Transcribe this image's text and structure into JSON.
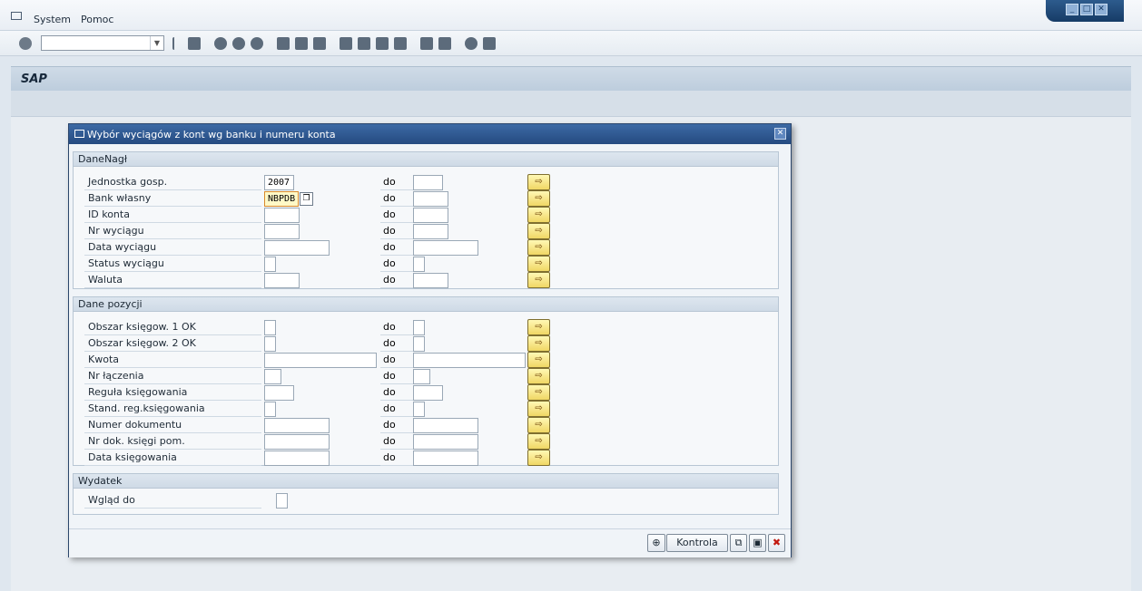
{
  "menu": {
    "system": "System",
    "pomoc": "Pomoc"
  },
  "window_controls": {
    "minimize": "_",
    "maximize": "□",
    "close": "✕"
  },
  "app": {
    "title": "SAP"
  },
  "dialog": {
    "title": "Wybór wyciągów z kont wg banku i numeru konta",
    "close": "✕",
    "groups": {
      "danenagl": {
        "title": "DaneNagł",
        "rows": [
          {
            "label": "Jednostka gosp.",
            "from": "2007",
            "to": "",
            "to_label": "do",
            "more": "⇨"
          },
          {
            "label": "Bank własny",
            "from": "NBPDB",
            "to": "",
            "to_label": "do",
            "more": "⇨"
          },
          {
            "label": "ID konta",
            "from": "",
            "to": "",
            "to_label": "do",
            "more": "⇨"
          },
          {
            "label": "Nr wyciągu",
            "from": "",
            "to": "",
            "to_label": "do",
            "more": "⇨"
          },
          {
            "label": "Data wyciągu",
            "from": "",
            "to": "",
            "to_label": "do",
            "more": "⇨"
          },
          {
            "label": "Status wyciągu",
            "from": "",
            "to": "",
            "to_label": "do",
            "more": "⇨"
          },
          {
            "label": "Waluta",
            "from": "",
            "to": "",
            "to_label": "do",
            "more": "⇨"
          }
        ]
      },
      "pozycji": {
        "title": "Dane pozycji",
        "rows": [
          {
            "label": "Obszar księgow. 1 OK",
            "from": "",
            "to": "",
            "to_label": "do",
            "more": "⇨"
          },
          {
            "label": "Obszar księgow. 2 OK",
            "from": "",
            "to": "",
            "to_label": "do",
            "more": "⇨"
          },
          {
            "label": "Kwota",
            "from": "",
            "to": "",
            "to_label": "do",
            "more": "⇨"
          },
          {
            "label": "Nr łączenia",
            "from": "",
            "to": "",
            "to_label": "do",
            "more": "⇨"
          },
          {
            "label": "Reguła księgowania",
            "from": "",
            "to": "",
            "to_label": "do",
            "more": "⇨"
          },
          {
            "label": "Stand. reg.księgowania",
            "from": "",
            "to": "",
            "to_label": "do",
            "more": "⇨"
          },
          {
            "label": "Numer dokumentu",
            "from": "",
            "to": "",
            "to_label": "do",
            "more": "⇨"
          },
          {
            "label": "Nr dok. księgi pom.",
            "from": "",
            "to": "",
            "to_label": "do",
            "more": "⇨"
          },
          {
            "label": "Data księgowania",
            "from": "",
            "to": "",
            "to_label": "do",
            "more": "⇨"
          }
        ]
      },
      "wydatek": {
        "title": "Wydatek",
        "rows": [
          {
            "label": "Wgląd do",
            "value": ""
          }
        ]
      }
    },
    "buttons": {
      "execute": "⊕",
      "check": "Kontrola",
      "copy": "⧉",
      "save": "▣",
      "cancel": "✖"
    }
  }
}
